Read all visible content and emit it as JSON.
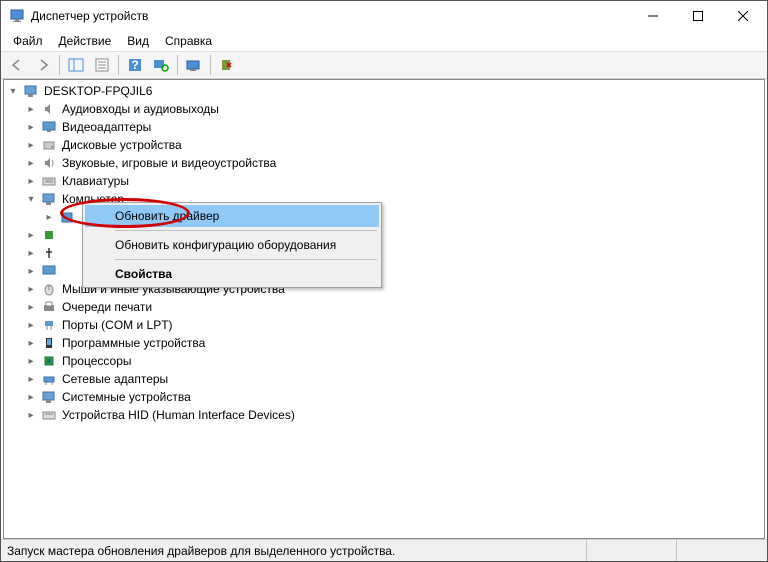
{
  "title": "Диспетчер устройств",
  "menu": {
    "file": "Файл",
    "action": "Действие",
    "view": "Вид",
    "help": "Справка"
  },
  "tree": {
    "root": "DESKTOP-FPQJIL6",
    "categories": [
      {
        "label": "Аудиовходы и аудиовыходы",
        "icon": "audio"
      },
      {
        "label": "Видеоадаптеры",
        "icon": "display"
      },
      {
        "label": "Дисковые устройства",
        "icon": "disk"
      },
      {
        "label": "Звуковые, игровые и видеоустройства",
        "icon": "sound"
      },
      {
        "label": "Клавиатуры",
        "icon": "keyboard"
      },
      {
        "label": "Компьютер",
        "icon": "computer",
        "expanded": true
      },
      {
        "label": "",
        "icon": "device-hidden1"
      },
      {
        "label": "",
        "icon": "device-hidden2"
      },
      {
        "label": "",
        "icon": "device-hidden3"
      },
      {
        "label": "",
        "icon": "device-hidden4"
      },
      {
        "label": "Мыши и иные указывающие устройства",
        "icon": "mouse"
      },
      {
        "label": "Очереди печати",
        "icon": "printer"
      },
      {
        "label": "Порты (COM и LPT)",
        "icon": "port"
      },
      {
        "label": "Программные устройства",
        "icon": "software"
      },
      {
        "label": "Процессоры",
        "icon": "cpu"
      },
      {
        "label": "Сетевые адаптеры",
        "icon": "network"
      },
      {
        "label": "Системные устройства",
        "icon": "system"
      },
      {
        "label": "Устройства HID (Human Interface Devices)",
        "icon": "hid"
      }
    ]
  },
  "context_menu": {
    "update_driver": "Обновить драйвер",
    "scan_hardware": "Обновить конфигурацию оборудования",
    "properties": "Свойства"
  },
  "status": "Запуск мастера обновления драйверов для выделенного устройства."
}
